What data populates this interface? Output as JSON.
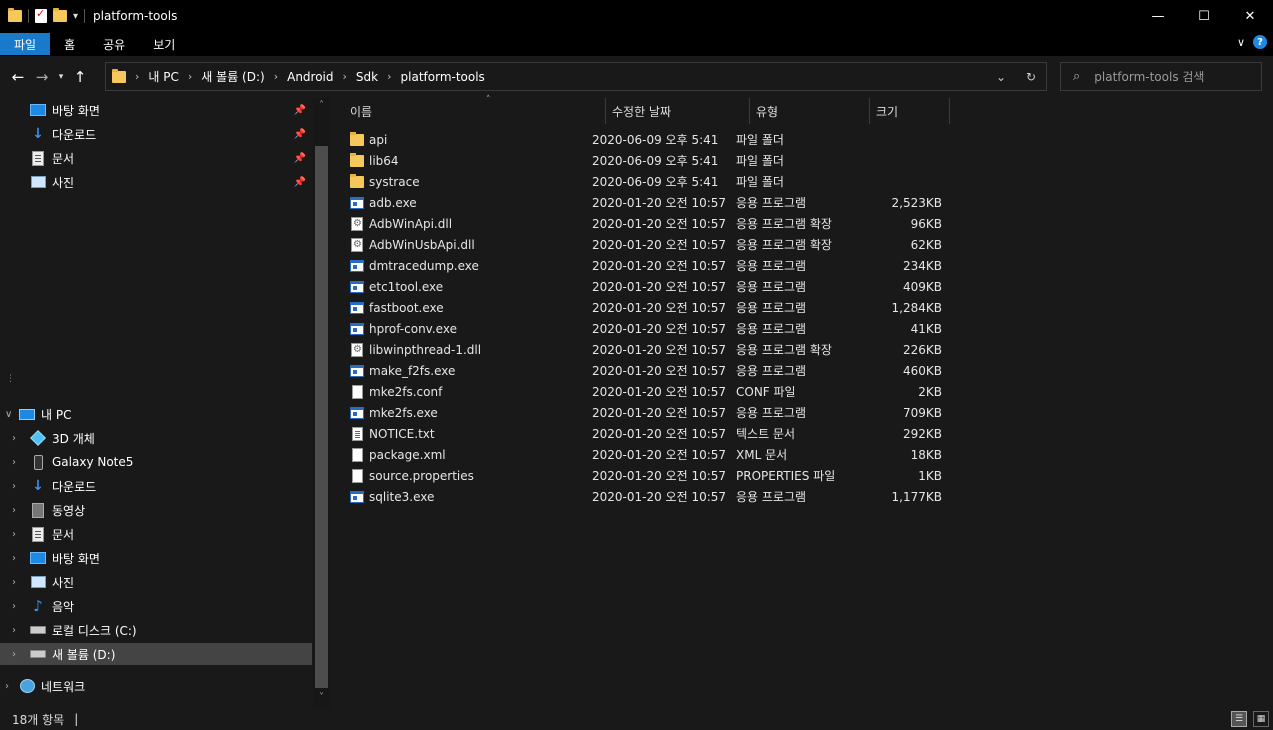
{
  "window": {
    "title": "platform-tools",
    "controls": {
      "minimize": "—",
      "maximize": "☐",
      "close": "✕"
    }
  },
  "ribbon": {
    "tabs": [
      "파일",
      "홈",
      "공유",
      "보기"
    ]
  },
  "address": {
    "breadcrumbs": [
      "내 PC",
      "새 볼륨 (D:)",
      "Android",
      "Sdk",
      "platform-tools"
    ]
  },
  "search": {
    "placeholder": "platform-tools 검색"
  },
  "nav": {
    "quick_access": [
      {
        "label": "바탕 화면",
        "icon": "desktop-icon"
      },
      {
        "label": "다운로드",
        "icon": "download-icon"
      },
      {
        "label": "문서",
        "icon": "documents-icon"
      },
      {
        "label": "사진",
        "icon": "pictures-icon"
      }
    ],
    "this_pc": "내 PC",
    "pc_items": [
      {
        "label": "3D 개체",
        "icon": "3d-objects-icon"
      },
      {
        "label": "Galaxy Note5",
        "icon": "phone-icon"
      },
      {
        "label": "다운로드",
        "icon": "download-icon"
      },
      {
        "label": "동영상",
        "icon": "videos-icon"
      },
      {
        "label": "문서",
        "icon": "documents-icon"
      },
      {
        "label": "바탕 화면",
        "icon": "desktop-icon"
      },
      {
        "label": "사진",
        "icon": "pictures-icon"
      },
      {
        "label": "음악",
        "icon": "music-icon"
      },
      {
        "label": "로컬 디스크 (C:)",
        "icon": "drive-icon"
      },
      {
        "label": "새 볼륨 (D:)",
        "icon": "drive-icon",
        "selected": true
      }
    ],
    "network": "네트워크"
  },
  "columns": {
    "name": "이름",
    "date": "수정한 날짜",
    "type": "유형",
    "size": "크기"
  },
  "files": [
    {
      "name": "api",
      "date": "2020-06-09 오후 5:41",
      "type": "파일 폴더",
      "size": "",
      "icon": "folder"
    },
    {
      "name": "lib64",
      "date": "2020-06-09 오후 5:41",
      "type": "파일 폴더",
      "size": "",
      "icon": "folder"
    },
    {
      "name": "systrace",
      "date": "2020-06-09 오후 5:41",
      "type": "파일 폴더",
      "size": "",
      "icon": "folder"
    },
    {
      "name": "adb.exe",
      "date": "2020-01-20 오전 10:57",
      "type": "응용 프로그램",
      "size": "2,523KB",
      "icon": "exe"
    },
    {
      "name": "AdbWinApi.dll",
      "date": "2020-01-20 오전 10:57",
      "type": "응용 프로그램 확장",
      "size": "96KB",
      "icon": "dll"
    },
    {
      "name": "AdbWinUsbApi.dll",
      "date": "2020-01-20 오전 10:57",
      "type": "응용 프로그램 확장",
      "size": "62KB",
      "icon": "dll"
    },
    {
      "name": "dmtracedump.exe",
      "date": "2020-01-20 오전 10:57",
      "type": "응용 프로그램",
      "size": "234KB",
      "icon": "exe"
    },
    {
      "name": "etc1tool.exe",
      "date": "2020-01-20 오전 10:57",
      "type": "응용 프로그램",
      "size": "409KB",
      "icon": "exe"
    },
    {
      "name": "fastboot.exe",
      "date": "2020-01-20 오전 10:57",
      "type": "응용 프로그램",
      "size": "1,284KB",
      "icon": "exe"
    },
    {
      "name": "hprof-conv.exe",
      "date": "2020-01-20 오전 10:57",
      "type": "응용 프로그램",
      "size": "41KB",
      "icon": "exe"
    },
    {
      "name": "libwinpthread-1.dll",
      "date": "2020-01-20 오전 10:57",
      "type": "응용 프로그램 확장",
      "size": "226KB",
      "icon": "dll"
    },
    {
      "name": "make_f2fs.exe",
      "date": "2020-01-20 오전 10:57",
      "type": "응용 프로그램",
      "size": "460KB",
      "icon": "exe"
    },
    {
      "name": "mke2fs.conf",
      "date": "2020-01-20 오전 10:57",
      "type": "CONF 파일",
      "size": "2KB",
      "icon": "file"
    },
    {
      "name": "mke2fs.exe",
      "date": "2020-01-20 오전 10:57",
      "type": "응용 프로그램",
      "size": "709KB",
      "icon": "exe"
    },
    {
      "name": "NOTICE.txt",
      "date": "2020-01-20 오전 10:57",
      "type": "텍스트 문서",
      "size": "292KB",
      "icon": "txt"
    },
    {
      "name": "package.xml",
      "date": "2020-01-20 오전 10:57",
      "type": "XML 문서",
      "size": "18KB",
      "icon": "file"
    },
    {
      "name": "source.properties",
      "date": "2020-01-20 오전 10:57",
      "type": "PROPERTIES 파일",
      "size": "1KB",
      "icon": "file"
    },
    {
      "name": "sqlite3.exe",
      "date": "2020-01-20 오전 10:57",
      "type": "응용 프로그램",
      "size": "1,177KB",
      "icon": "exe"
    }
  ],
  "status": {
    "count": "18개 항목"
  }
}
